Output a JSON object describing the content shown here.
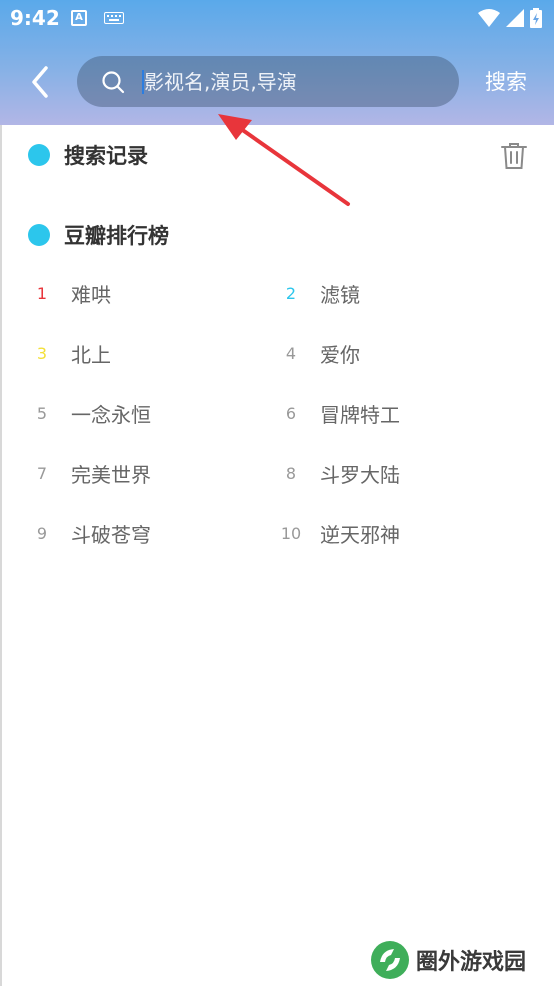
{
  "status_bar": {
    "time": "9:42",
    "app_icon_letter": "A"
  },
  "header": {
    "search_placeholder": "影视名,演员,导演",
    "search_button": "搜索"
  },
  "history": {
    "title": "搜索记录"
  },
  "ranking": {
    "title": "豆瓣排行榜",
    "items": [
      {
        "rank": "1",
        "name": "难哄",
        "rank_color": "#e8353b"
      },
      {
        "rank": "2",
        "name": "滤镜",
        "rank_color": "#2cc6ec"
      },
      {
        "rank": "3",
        "name": "北上",
        "rank_color": "#f3e03a"
      },
      {
        "rank": "4",
        "name": "爱你",
        "rank_color": "#999999"
      },
      {
        "rank": "5",
        "name": "一念永恒",
        "rank_color": "#999999"
      },
      {
        "rank": "6",
        "name": "冒牌特工",
        "rank_color": "#999999"
      },
      {
        "rank": "7",
        "name": "完美世界",
        "rank_color": "#999999"
      },
      {
        "rank": "8",
        "name": "斗罗大陆",
        "rank_color": "#999999"
      },
      {
        "rank": "9",
        "name": "斗破苍穹",
        "rank_color": "#999999"
      },
      {
        "rank": "10",
        "name": "逆天邪神",
        "rank_color": "#999999"
      }
    ]
  },
  "watermark": {
    "text": "圈外游戏园"
  },
  "colors": {
    "accent": "#2cc6ec",
    "header_top": "#5aa9ea",
    "header_bottom": "#b2b6e6",
    "arrow": "#e8353b"
  }
}
